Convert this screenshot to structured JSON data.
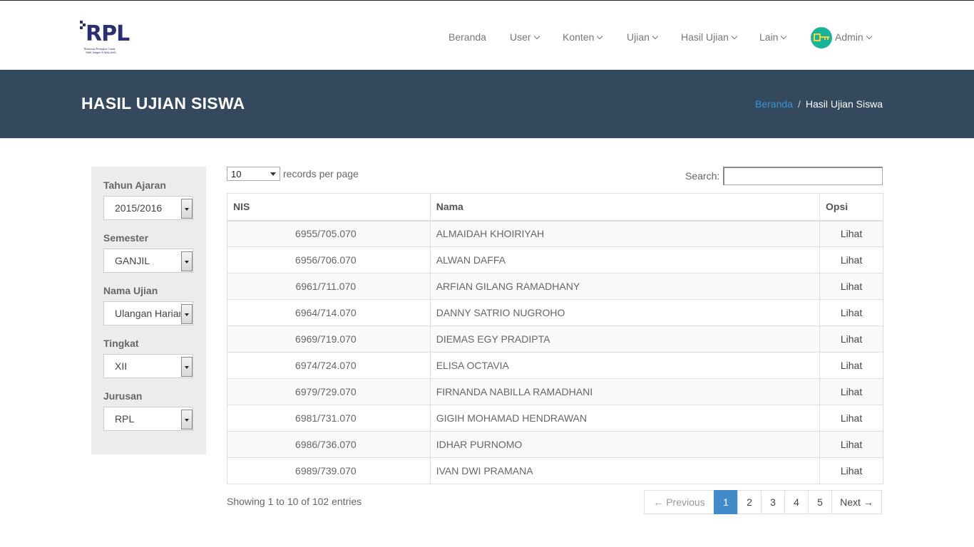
{
  "brand": {
    "logo_text": "RPL",
    "logo_sub1": "Rekayasa Perangkat Lunak",
    "logo_sub2": "SMK Negeri 5 MALANG"
  },
  "nav": {
    "items": [
      {
        "label": "Beranda",
        "has_caret": false
      },
      {
        "label": "User",
        "has_caret": true
      },
      {
        "label": "Konten",
        "has_caret": true
      },
      {
        "label": "Ujian",
        "has_caret": true
      },
      {
        "label": "Hasil Ujian",
        "has_caret": true
      },
      {
        "label": "Lain",
        "has_caret": true
      }
    ],
    "user": {
      "label": "Admin",
      "icon": "key-icon",
      "avatar_color": "#18b49a"
    }
  },
  "header": {
    "title": "HASIL UJIAN SISWA",
    "breadcrumb": [
      "Beranda",
      "Hasil Ujian Siswa"
    ],
    "background": "#34495e"
  },
  "filters": [
    {
      "label": "Tahun Ajaran",
      "value": "2015/2016"
    },
    {
      "label": "Semester",
      "value": "GANJIL"
    },
    {
      "label": "Nama Ujian",
      "value": "Ulangan Harian"
    },
    {
      "label": "Tingkat",
      "value": "XII"
    },
    {
      "label": "Jurusan",
      "value": "RPL"
    }
  ],
  "table_controls": {
    "page_length": "10",
    "page_length_label": "records per page",
    "search_label": "Search:",
    "search_value": ""
  },
  "table": {
    "columns": [
      "NIS",
      "Nama",
      "Opsi"
    ],
    "rows": [
      {
        "nis": "6955/705.070",
        "nama": "ALMAIDAH KHOIRIYAH",
        "opsi": "Lihat"
      },
      {
        "nis": "6956/706.070",
        "nama": "ALWAN DAFFA",
        "opsi": "Lihat"
      },
      {
        "nis": "6961/711.070",
        "nama": "ARFIAN GILANG RAMADHANY",
        "opsi": "Lihat"
      },
      {
        "nis": "6964/714.070",
        "nama": "DANNY SATRIO NUGROHO",
        "opsi": "Lihat"
      },
      {
        "nis": "6969/719.070",
        "nama": "DIEMAS EGY PRADIPTA",
        "opsi": "Lihat"
      },
      {
        "nis": "6974/724.070",
        "nama": "ELISA OCTAVIA",
        "opsi": "Lihat"
      },
      {
        "nis": "6979/729.070",
        "nama": "FIRNANDA NABILLA RAMADHANI",
        "opsi": "Lihat"
      },
      {
        "nis": "6981/731.070",
        "nama": "GIGIH MOHAMAD HENDRAWAN",
        "opsi": "Lihat"
      },
      {
        "nis": "6986/736.070",
        "nama": "IDHAR PURNOMO",
        "opsi": "Lihat"
      },
      {
        "nis": "6989/739.070",
        "nama": "IVAN DWI PRAMANA",
        "opsi": "Lihat"
      }
    ]
  },
  "footer": {
    "info": "Showing 1 to 10 of 102 entries",
    "pagination": {
      "previous": "← Previous",
      "pages": [
        "1",
        "2",
        "3",
        "4",
        "5"
      ],
      "active": "1",
      "next": "Next →"
    }
  },
  "colors": {
    "accent": "#428bca",
    "link": "#3b94d9"
  }
}
